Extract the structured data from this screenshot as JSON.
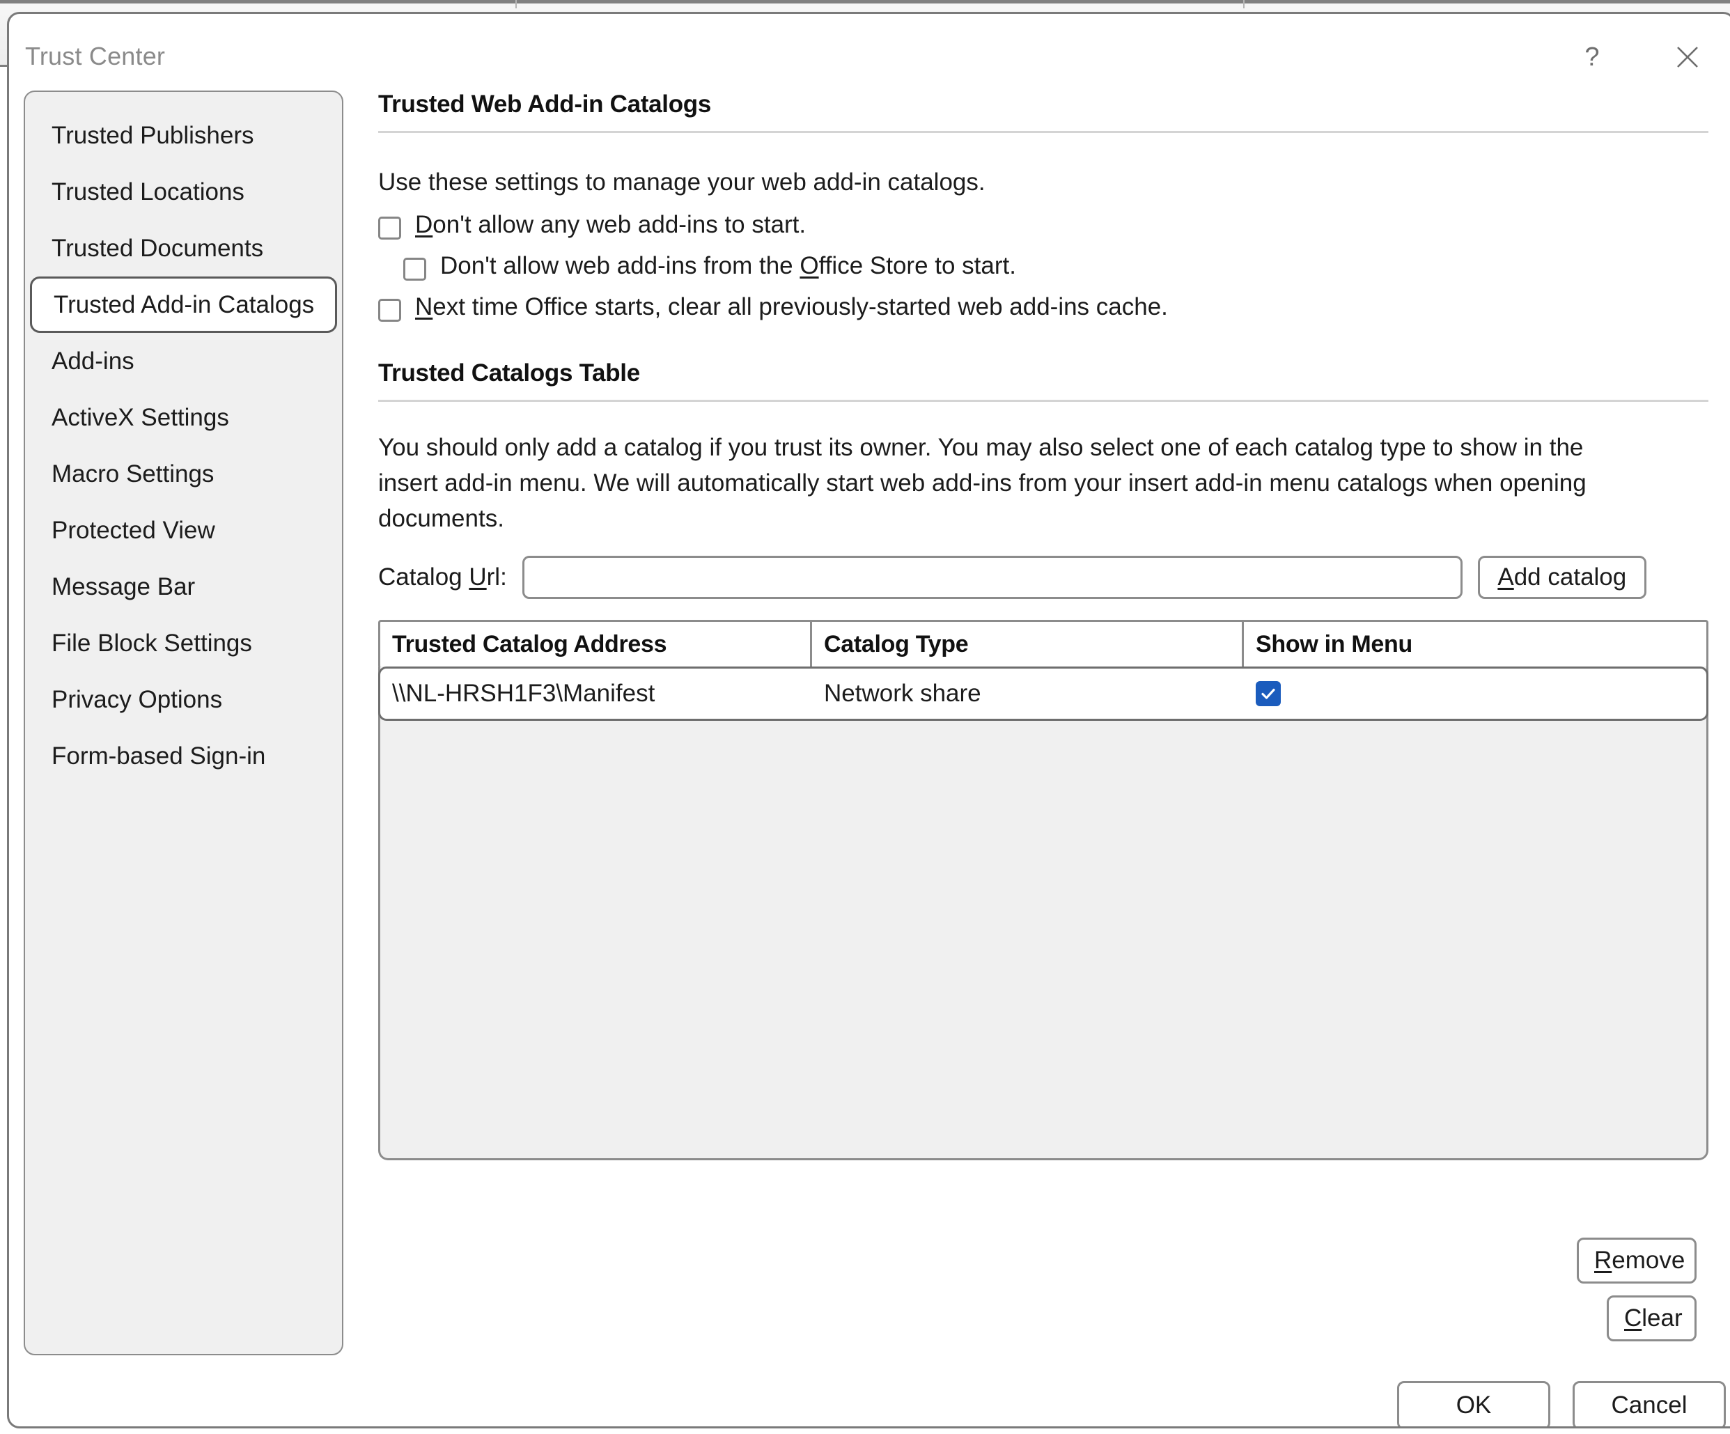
{
  "window": {
    "title": "Trust Center",
    "help_icon": "question-mark-icon",
    "close_icon": "close-icon"
  },
  "sidebar": {
    "items": [
      {
        "label": "Trusted Publishers",
        "selected": false
      },
      {
        "label": "Trusted Locations",
        "selected": false
      },
      {
        "label": "Trusted Documents",
        "selected": false
      },
      {
        "label": "Trusted Add-in Catalogs",
        "selected": true
      },
      {
        "label": "Add-ins",
        "selected": false
      },
      {
        "label": "ActiveX Settings",
        "selected": false
      },
      {
        "label": "Macro Settings",
        "selected": false
      },
      {
        "label": "Protected View",
        "selected": false
      },
      {
        "label": "Message Bar",
        "selected": false
      },
      {
        "label": "File Block Settings",
        "selected": false
      },
      {
        "label": "Privacy Options",
        "selected": false
      },
      {
        "label": "Form-based Sign-in",
        "selected": false
      }
    ]
  },
  "web_addin_catalogs": {
    "heading": "Trusted Web Add-in Catalogs",
    "intro": "Use these settings to manage your web add-in catalogs.",
    "checkboxes": [
      {
        "accel": "D",
        "rest": "on't allow any web add-ins to start.",
        "pre": "",
        "checked": false,
        "indented": false
      },
      {
        "pre": "Don't allow web add-ins from the ",
        "accel": "O",
        "rest": "ffice Store to start.",
        "checked": false,
        "indented": true
      },
      {
        "pre": "",
        "accel": "N",
        "rest": "ext time Office starts, clear all previously-started web add-ins cache.",
        "checked": false,
        "indented": false
      }
    ]
  },
  "catalogs_table": {
    "heading": "Trusted Catalogs Table",
    "description": "You should only add a catalog if you trust its owner. You may also select one of each catalog type to show in the insert add-in menu. We will automatically start web add-ins from your insert add-in menu catalogs when opening documents.",
    "url_label_pre": "Catalog ",
    "url_label_accel": "U",
    "url_label_rest": "rl:",
    "url_value": "",
    "url_placeholder": "",
    "add_button_accel": "A",
    "add_button_rest": "dd catalog",
    "columns": [
      "Trusted Catalog Address",
      "Catalog Type",
      "Show in Menu"
    ],
    "rows": [
      {
        "address": "\\\\NL-HRSH1F3\\Manifest",
        "type": "Network share",
        "show_in_menu": true
      }
    ],
    "remove_accel": "R",
    "remove_rest": "emove",
    "clear_accel": "C",
    "clear_rest": "lear"
  },
  "footer": {
    "ok_label": "OK",
    "cancel_label": "Cancel"
  },
  "colors": {
    "checkbox_checked": "#1b5cbd",
    "border": "#8c8c8c",
    "sidebar_bg": "#f0f0f0",
    "title_text": "#8a8a8a"
  }
}
